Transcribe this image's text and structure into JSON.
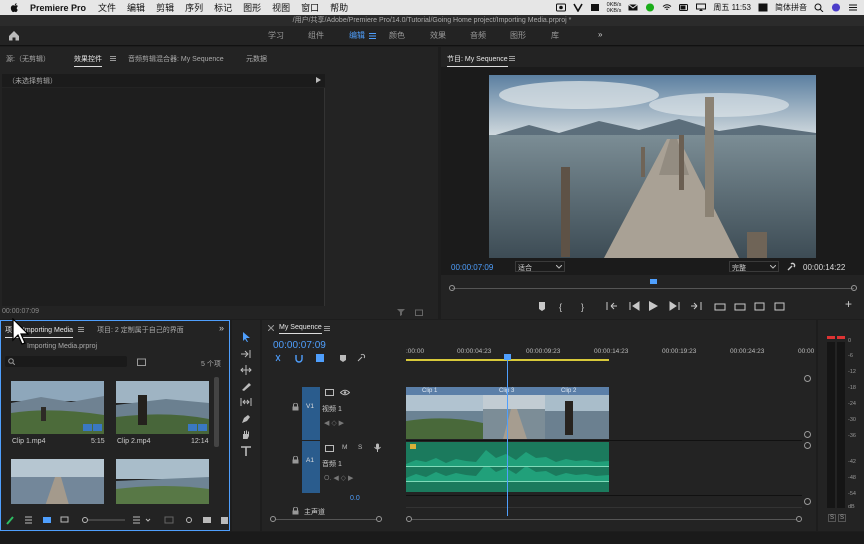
{
  "menubar": {
    "app_name": "Premiere Pro",
    "items": [
      "文件",
      "编辑",
      "剪辑",
      "序列",
      "标记",
      "图形",
      "视图",
      "窗口",
      "帮助"
    ],
    "net_up": "0KB/s",
    "net_down": "0KB/s",
    "clock": "周五 11:53",
    "input_method": "简体拼音"
  },
  "window": {
    "title": "/用户/共享/Adobe/Premiere Pro/14.0/Tutorial/Going Home project/Importing Media.prproj *"
  },
  "workspaces": {
    "items": [
      "学习",
      "组件",
      "编辑",
      "颜色",
      "效果",
      "音频",
      "图形",
      "库"
    ],
    "active": "编辑",
    "more": "»"
  },
  "source_panel": {
    "tabs": [
      "源:（无剪辑）",
      "效果控件",
      "音频剪辑混合器: My Sequence",
      "元数据"
    ],
    "active_tab": "效果控件",
    "no_clip_text": "（未选择剪辑）",
    "timecode": "00:00:07:09"
  },
  "program_monitor": {
    "title": "节目: My Sequence",
    "timecode_current": "00:00:07:09",
    "zoom": "适合",
    "quality": "完整",
    "timecode_duration": "00:00:14:22",
    "playhead_fraction": 0.5
  },
  "project_panel": {
    "tabs": [
      "项目: Importing Media",
      "项目: 2 定制属于自己的界面"
    ],
    "file_name": "Importing Media.prproj",
    "item_count": "5 个项",
    "clips": [
      {
        "name": "Clip 1.mp4",
        "duration": "5:15"
      },
      {
        "name": "Clip 2.mp4",
        "duration": "12:14"
      },
      {
        "name": "",
        "duration": ""
      },
      {
        "name": "",
        "duration": ""
      }
    ]
  },
  "timeline": {
    "title": "My Sequence",
    "timecode": "00:00:07:09",
    "ruler": [
      ":00:00",
      "00:00:04:23",
      "00:00:09:23",
      "00:00:14:23",
      "00:00:19:23",
      "00:00:24:23",
      "00:00"
    ],
    "tracks": {
      "video_label": "V1",
      "video_name": "视频 1",
      "audio_label": "A1",
      "audio_name": "音频 1",
      "master": "主声道",
      "master_level": "0.0"
    },
    "clips": [
      "Clip 1",
      "Clip 3",
      "Clip 2"
    ],
    "playhead_fraction": 0.255
  },
  "audio_meter": {
    "scale": [
      "0",
      "-6",
      "-12",
      "-18",
      "-24",
      "-30",
      "-36",
      "-42",
      "-48",
      "-54",
      "dB"
    ],
    "solo": [
      "S",
      "S"
    ]
  },
  "colors": {
    "accent": "#4f9ffd",
    "clip_video": "#5b7fa8",
    "clip_audio": "#21a07a",
    "track_header": "#2a5c8d",
    "background": "#232323"
  }
}
